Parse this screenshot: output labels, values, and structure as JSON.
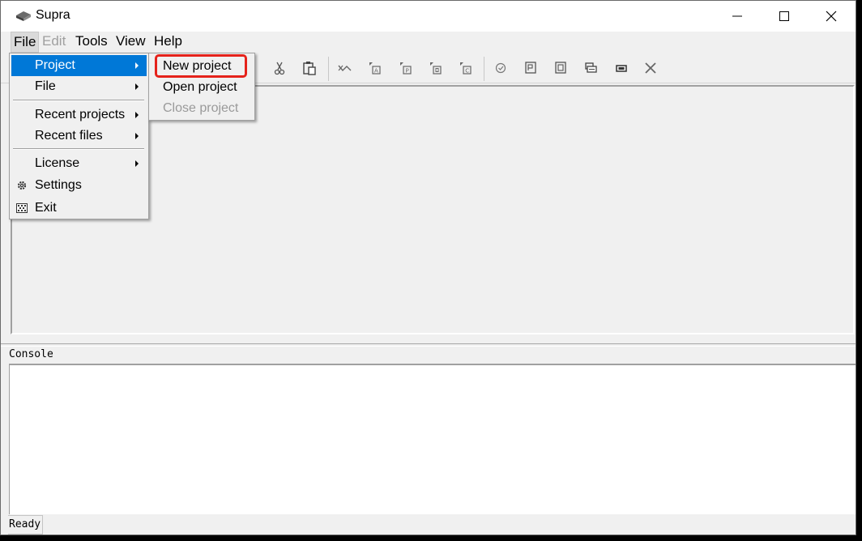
{
  "window": {
    "title": "Supra"
  },
  "menubar": {
    "file": "File",
    "edit": "Edit",
    "tools": "Tools",
    "view": "View",
    "help": "Help"
  },
  "file_menu": {
    "project": "Project",
    "file": "File",
    "recent_projects": "Recent projects",
    "recent_files": "Recent files",
    "license": "License",
    "settings": "Settings",
    "exit": "Exit"
  },
  "project_submenu": {
    "new_project": "New project",
    "open_project": "Open project",
    "close_project": "Close project"
  },
  "console": {
    "label": "Console"
  },
  "status": {
    "text": "Ready"
  },
  "colors": {
    "selection": "#0078d7",
    "highlight": "#e5221b"
  }
}
